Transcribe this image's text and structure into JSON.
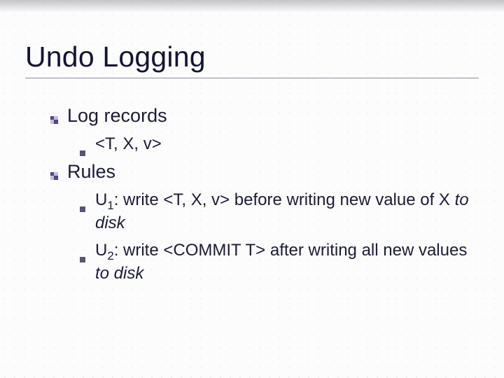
{
  "slide": {
    "title": "Undo Logging",
    "items": [
      {
        "label": "Log records",
        "sub": [
          {
            "text": "<T, X, v>"
          }
        ]
      },
      {
        "label": "Rules",
        "sub": [
          {
            "u_label": "U",
            "u_index": "1",
            "lead": ": write <T, X, v> ",
            "emph": "before",
            "tail1": " writing new value of X ",
            "ital1": "to disk"
          },
          {
            "u_label": "U",
            "u_index": "2",
            "lead": ": write <COMMIT T> ",
            "emph": "after",
            "tail1": " writing all new values ",
            "ital1": "to disk"
          }
        ]
      }
    ]
  }
}
